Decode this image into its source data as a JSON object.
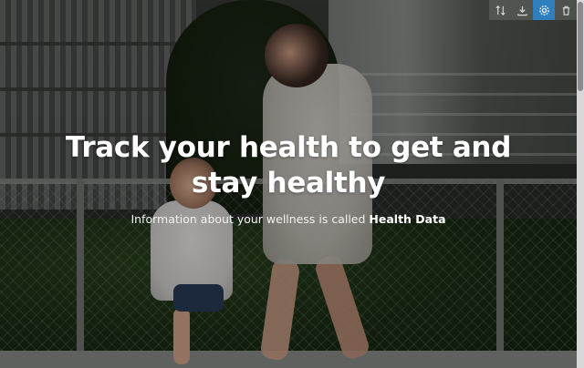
{
  "hero": {
    "headline": "Track your health to get and stay healthy",
    "subtitle_prefix": "Information about your wellness is called ",
    "subtitle_emphasis": "Health Data"
  },
  "toolbar": {
    "tools": [
      {
        "icon": "sort-arrows-icon"
      },
      {
        "icon": "download-icon"
      },
      {
        "icon": "gear-icon",
        "active": true
      },
      {
        "icon": "trash-icon"
      }
    ],
    "active_color": "#2f7fbf"
  },
  "colors": {
    "headline": "#ffffff",
    "overlay": "rgba(0,0,0,0.32)"
  }
}
